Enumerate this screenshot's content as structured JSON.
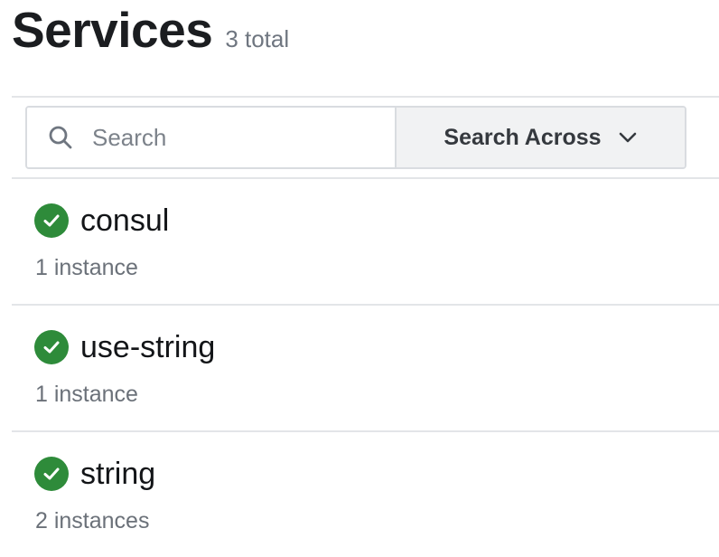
{
  "header": {
    "title": "Services",
    "total": "3 total"
  },
  "search": {
    "placeholder": "Search",
    "value": "",
    "across_label": "Search Across"
  },
  "icons": {
    "search": "search-icon",
    "dropdown": "chevron-down-icon",
    "status": "check-circle-icon"
  },
  "colors": {
    "status_passing": "#2e8b3a"
  },
  "services": [
    {
      "name": "consul",
      "instances": "1 instance",
      "status": "passing"
    },
    {
      "name": "use-string",
      "instances": "1 instance",
      "status": "passing"
    },
    {
      "name": "string",
      "instances": "2 instances",
      "status": "passing"
    }
  ]
}
